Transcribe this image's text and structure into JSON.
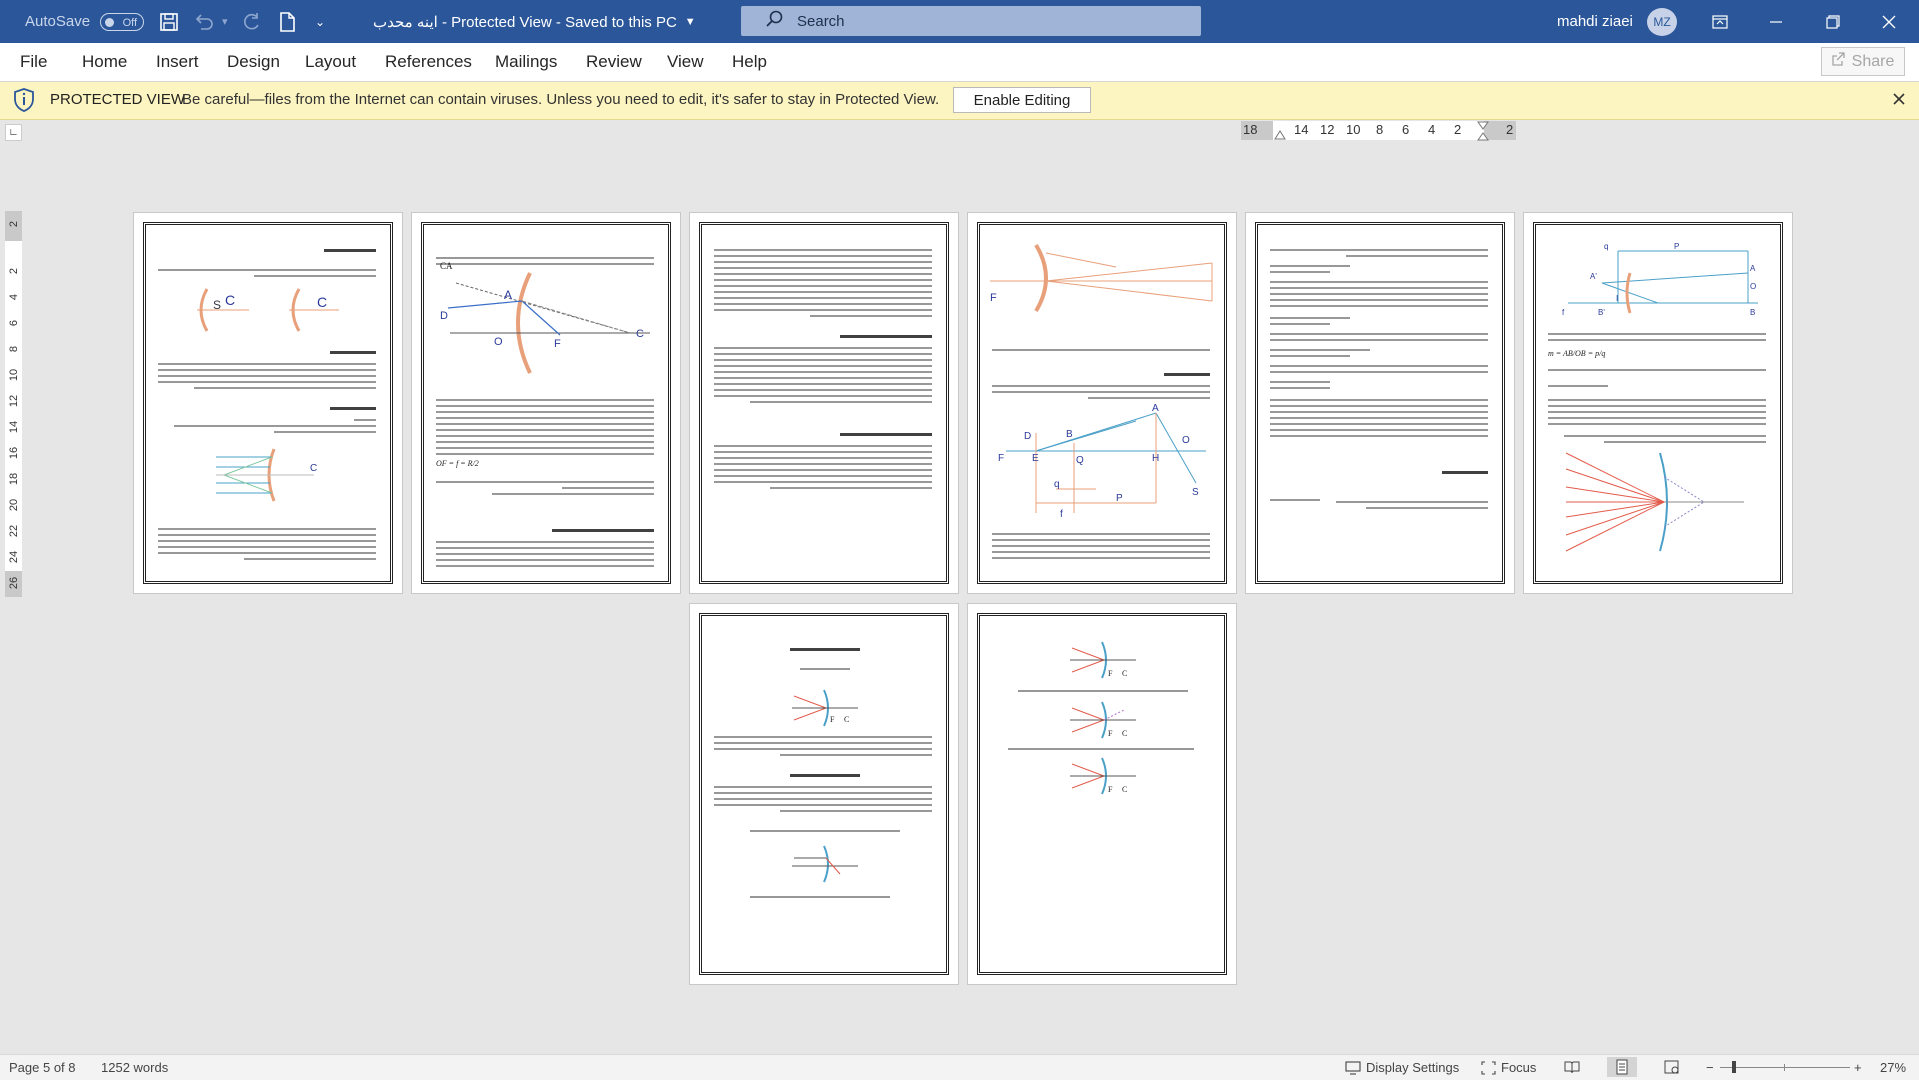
{
  "titlebar": {
    "autosave_label": "AutoSave",
    "autosave_state": "Off",
    "doc_title": "اینه محدب  -  Protected View  -  Saved to this PC",
    "search_placeholder": "Search",
    "user_name": "mahdi ziaei",
    "user_initials": "MZ"
  },
  "ribbon": {
    "tabs": [
      "File",
      "Home",
      "Insert",
      "Design",
      "Layout",
      "References",
      "Mailings",
      "Review",
      "View",
      "Help"
    ],
    "share_label": "Share"
  },
  "protected_view": {
    "title": "PROTECTED VIEW",
    "message": "Be careful—files from the Internet can contain viruses. Unless you need to edit, it's safer to stay in Protected View.",
    "enable_button": "Enable Editing"
  },
  "ruler": {
    "horizontal": [
      "18",
      "14",
      "12",
      "10",
      "8",
      "6",
      "4",
      "2",
      "2"
    ],
    "vertical": [
      "2",
      "2",
      "4",
      "6",
      "8",
      "10",
      "12",
      "14",
      "16",
      "18",
      "20",
      "22",
      "24",
      "26"
    ]
  },
  "pages": {
    "p1": {
      "label_s": "S",
      "label_c": "C",
      "label_c2": "C",
      "label_c3": "C"
    },
    "p2": {
      "labels": [
        "CA",
        "A",
        "D",
        "O",
        "F",
        "C"
      ],
      "formula": "OF = f = R/2"
    },
    "p4": {
      "labels": [
        "F",
        "D",
        "B",
        "A",
        "O",
        "F",
        "E",
        "H",
        "Q",
        "S",
        "q",
        "P",
        "f"
      ]
    },
    "p6": {
      "labels": [
        "q",
        "P",
        "A'",
        "A",
        "O",
        "B",
        "f",
        "B'",
        "I"
      ],
      "formula": "m = AB/OB = p/q"
    },
    "p7": {
      "labels": [
        "F",
        "C"
      ]
    },
    "p8": {
      "labels": [
        "F",
        "C",
        "F",
        "C",
        "F",
        "C"
      ]
    }
  },
  "statusbar": {
    "page_info": "Page 5 of 8",
    "word_count": "1252 words",
    "display_settings": "Display Settings",
    "focus": "Focus",
    "zoom": "27%"
  }
}
